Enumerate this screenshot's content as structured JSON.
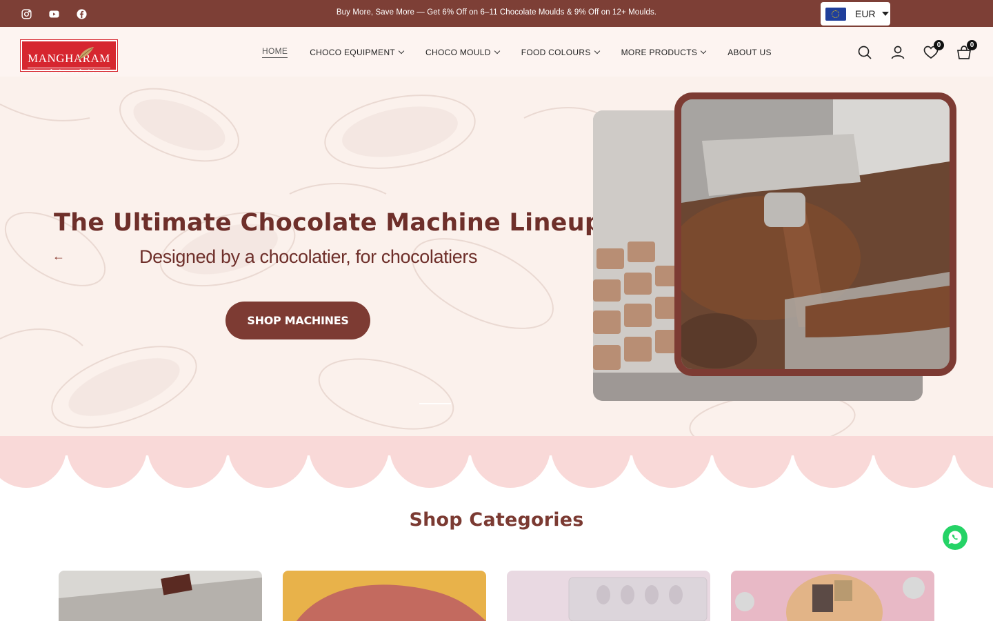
{
  "topbar": {
    "announcement": "Buy More, Save More — Get 6% Off on 6–11 Chocolate Moulds & 9% Off on 12+ Moulds.",
    "social": [
      "instagram-icon",
      "youtube-icon",
      "facebook-icon"
    ],
    "currency": {
      "code": "EUR",
      "flag": "eu-flag-icon"
    }
  },
  "header": {
    "logo": {
      "name": "MANGHARAM",
      "tagline": "chocolate solutions"
    },
    "nav": [
      {
        "label": "HOME",
        "active": true,
        "has_dropdown": false
      },
      {
        "label": "CHOCO EQUIPMENT",
        "active": false,
        "has_dropdown": true
      },
      {
        "label": "CHOCO MOULD",
        "active": false,
        "has_dropdown": true
      },
      {
        "label": "FOOD COLOURS",
        "active": false,
        "has_dropdown": true
      },
      {
        "label": "MORE PRODUCTS",
        "active": false,
        "has_dropdown": true
      },
      {
        "label": "ABOUT US",
        "active": false,
        "has_dropdown": false
      }
    ],
    "wishlist_count": "0",
    "cart_count": "0"
  },
  "hero": {
    "title": "The Ultimate Chocolate Machine Lineup",
    "subtitle": "Designed  by a chocolatier, for chocolatiers",
    "cta": "SHOP MACHINES",
    "prev_arrow": "←"
  },
  "categories": {
    "title": "Shop Categories"
  },
  "colors": {
    "brand": "#7d3f36",
    "hero_bg": "#fbf1ec",
    "scallop": "#f9d9d8",
    "logo_red": "#d6262f",
    "whatsapp": "#25d366"
  }
}
